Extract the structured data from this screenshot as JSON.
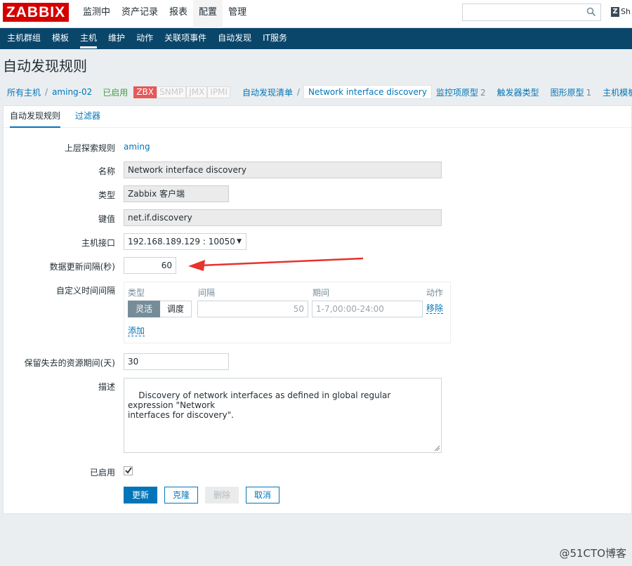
{
  "logo": "ZABBIX",
  "top_menu": [
    "监测中",
    "资产记录",
    "报表",
    "配置",
    "管理"
  ],
  "search": {
    "placeholder": ""
  },
  "share_label": "Sh",
  "sub_menu": [
    "主机群组",
    "模板",
    "主机",
    "维护",
    "动作",
    "关联项事件",
    "自动发现",
    "IT服务"
  ],
  "page_title": "自动发现规则",
  "breadcrumb": {
    "all_hosts": "所有主机",
    "sep": "/",
    "host": "aming-02",
    "status": "已启用",
    "tags": [
      "ZBX",
      "SNMP",
      "JMX",
      "IPMI"
    ],
    "discovery_list": "自动发现清单",
    "current": "Network interface discovery",
    "items": [
      {
        "label": "监控项原型",
        "count": "2"
      },
      {
        "label": "触发器类型",
        "count": ""
      },
      {
        "label": "图形原型",
        "count": "1"
      },
      {
        "label": "主机模板",
        "count": ""
      }
    ]
  },
  "tabs": [
    "自动发现规则",
    "过滤器"
  ],
  "form": {
    "parent_label": "上层探索规则",
    "parent_value": "aming",
    "name_label": "名称",
    "name_value": "Network interface discovery",
    "type_label": "类型",
    "type_value": "Zabbix 客户端",
    "key_label": "键值",
    "key_value": "net.if.discovery",
    "interface_label": "主机接口",
    "interface_value": "192.168.189.129 : 10050",
    "update_label": "数据更新间隔(秒)",
    "update_value": "60",
    "custom_label": "自定义时间间隔",
    "custom": {
      "col_type": "类型",
      "col_interval": "间隔",
      "col_period": "期间",
      "col_action": "动作",
      "mode_flexible": "灵活",
      "mode_scheduling": "调度",
      "interval_value": "50",
      "period_value": "1-7,00:00-24:00",
      "remove": "移除",
      "add": "添加"
    },
    "keep_label": "保留失去的资源期间(天)",
    "keep_value": "30",
    "desc_label": "描述",
    "desc_value": "Discovery of network interfaces as defined in global regular expression \"Network\ninterfaces for discovery\".",
    "enabled_label": "已启用"
  },
  "buttons": {
    "update": "更新",
    "clone": "克隆",
    "delete": "删除",
    "cancel": "取消"
  },
  "watermark": "@51CTO博客",
  "annotation_color": "#e8322a"
}
